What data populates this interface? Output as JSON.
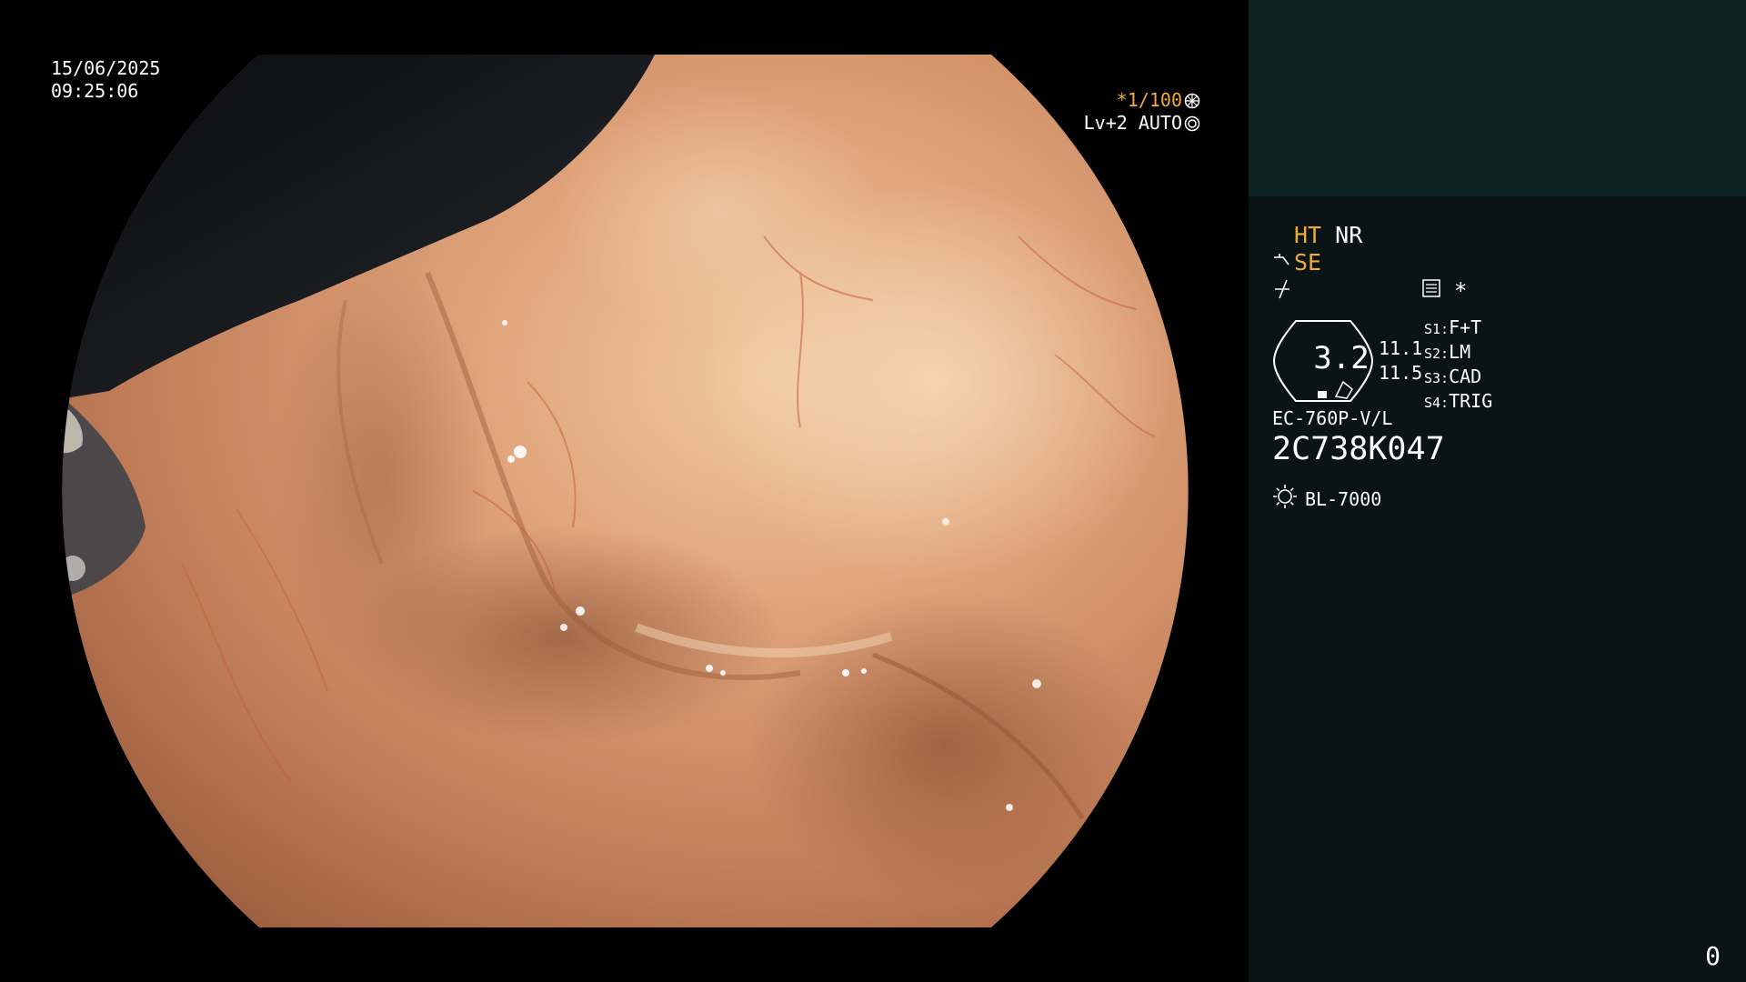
{
  "overlay": {
    "date": "15/06/2025",
    "time": "09:25:06",
    "shutter_speed": "*1/100",
    "iris": "Lv+2 AUTO"
  },
  "side_panel": {
    "ht": "HT",
    "nr": "NR",
    "se": "SE",
    "memo_mark": "*",
    "zoom_value": "3.2",
    "stat_1": "11.1",
    "stat_2": "11.5",
    "switches": [
      {
        "key": "S1:",
        "value": "F+T"
      },
      {
        "key": "S2:",
        "value": "LM"
      },
      {
        "key": "S3:",
        "value": "CAD"
      },
      {
        "key": "S4:",
        "value": "TRIG"
      }
    ],
    "scope_model": "EC-760P-V/L",
    "scope_serial": "2C738K047",
    "light_source": "BL-7000",
    "page_counter": "0"
  },
  "colors": {
    "accent_orange": "#f2a93b",
    "panel_bg": "#0a1414",
    "panel_top_bg": "#0d2222",
    "tissue_base": "#c98a62"
  },
  "icons": [
    "shutter-icon",
    "iris-icon",
    "scope-tip-icon",
    "freeze-icon",
    "memo-icon",
    "light-source-icon"
  ]
}
